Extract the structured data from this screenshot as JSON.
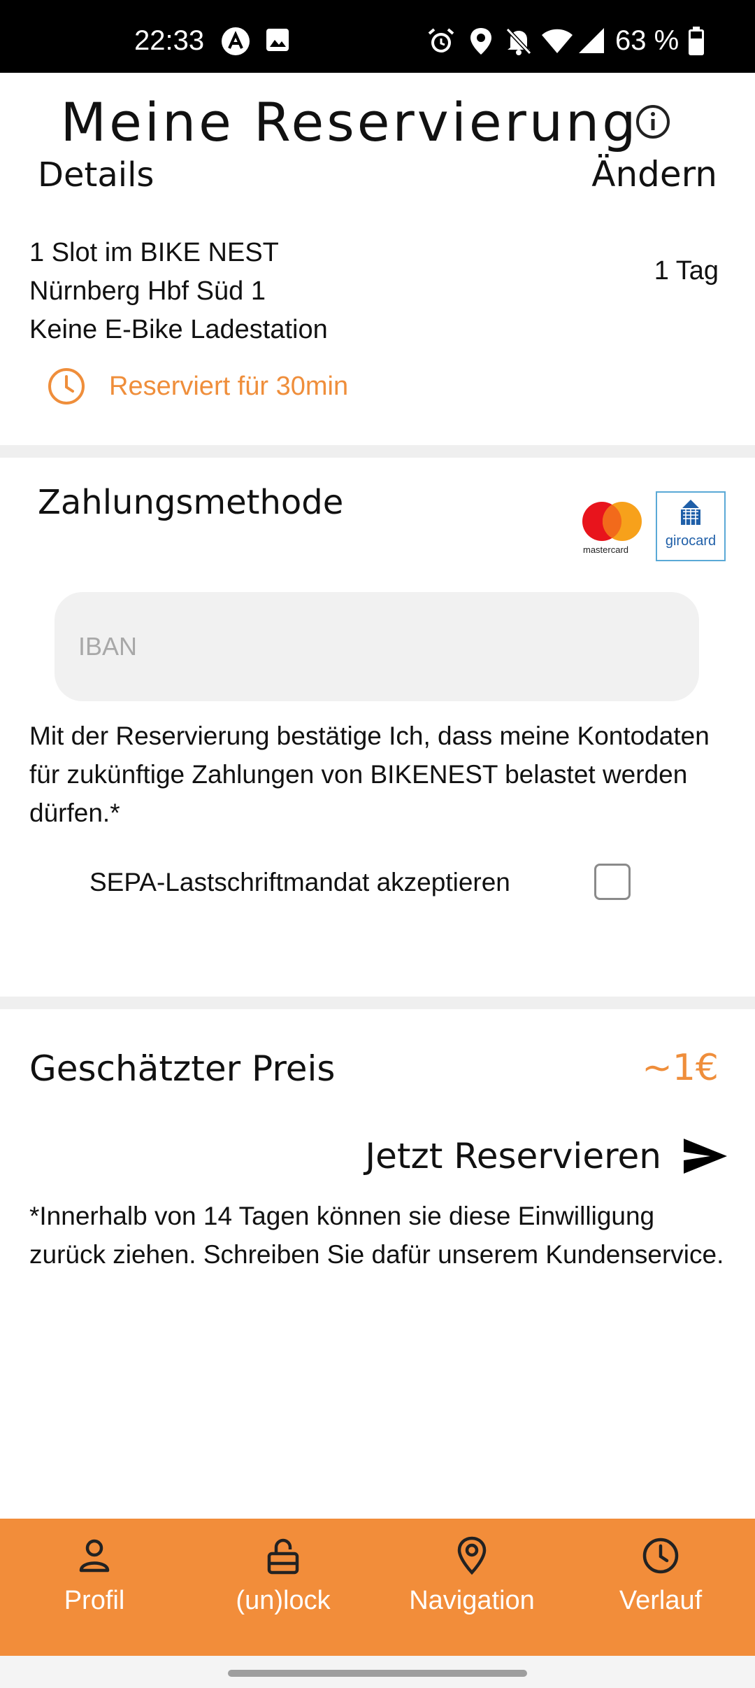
{
  "status_bar": {
    "time": "22:33",
    "battery": "63 %",
    "icons": [
      "app-a-icon",
      "image-icon",
      "alarm-icon",
      "location-icon",
      "bell-off-icon",
      "wifi-icon",
      "signal-icon",
      "battery-icon"
    ]
  },
  "header": {
    "title": "Meine Reservierung",
    "info_icon": "info-icon"
  },
  "details": {
    "heading": "Details",
    "edit_label": "Ändern",
    "lines": [
      "1 Slot im BIKE NEST",
      "Nürnberg Hbf Süd 1",
      "Keine E-Bike Ladestation"
    ],
    "duration": "1 Tag",
    "reserved_text": "Reserviert für 30min"
  },
  "payment": {
    "heading": "Zahlungsmethode",
    "logos": {
      "mastercard_text": "mastercard",
      "girocard_text": "girocard"
    },
    "iban_placeholder": "IBAN",
    "consent_text": "Mit der Reservierung bestätige Ich, dass meine Kontodaten für zukünftige Zahlungen von BIKENEST belastet werden dürfen.*",
    "sepa_label": "SEPA-Lastschriftmandat akzeptieren",
    "sepa_checked": false
  },
  "price": {
    "label": "Geschätzter Preis",
    "value": "~1€",
    "reserve_button": "Jetzt Reservieren",
    "footnote": "*Innerhalb von 14 Tagen können sie diese Einwilligung zurück ziehen. Schreiben Sie dafür unserem Kundenservice."
  },
  "nav": {
    "items": [
      {
        "label": "Profil",
        "icon": "person-icon"
      },
      {
        "label": "(un)lock",
        "icon": "lock-icon"
      },
      {
        "label": "Navigation",
        "icon": "map-pin-icon"
      },
      {
        "label": "Verlauf",
        "icon": "clock-icon"
      }
    ]
  },
  "colors": {
    "accent": "#f28d3a",
    "accent_text": "#ef8e3b",
    "divider": "#efefef",
    "input_bg": "#f1f1f1"
  }
}
